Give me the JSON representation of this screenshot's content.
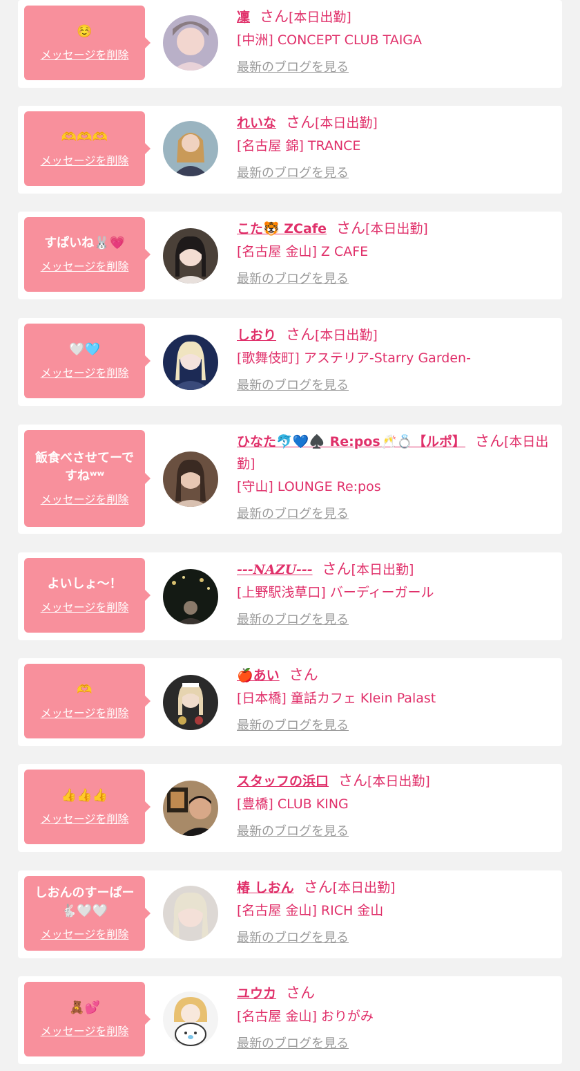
{
  "entries": [
    {
      "message": "☺️",
      "delete_label": "メッセージを削除",
      "name": "凜",
      "san": "さん",
      "status": "[本日出勤]",
      "shop": "[中洲] CONCEPT CLUB TAIGA",
      "blog_label": "最新のブログを見る"
    },
    {
      "message": "🫶🫶🫶",
      "delete_label": "メッセージを削除",
      "name": "れいな",
      "san": "さん",
      "status": "[本日出勤]",
      "shop": "[名古屋 錦] TRANCE",
      "blog_label": "最新のブログを見る"
    },
    {
      "message": "すぱいね🐰💗",
      "delete_label": "メッセージを削除",
      "name": "こた🐯 ZCafe",
      "san": "さん",
      "status": "[本日出勤]",
      "shop": "[名古屋 金山] Z CAFE",
      "blog_label": "最新のブログを見る"
    },
    {
      "message": "🤍🩵",
      "delete_label": "メッセージを削除",
      "name": "しおり",
      "san": "さん",
      "status": "[本日出勤]",
      "shop": "[歌舞伎町] アステリア-Starry Garden-",
      "blog_label": "最新のブログを見る"
    },
    {
      "message": "飯食べさせてーですねʷʷ",
      "delete_label": "メッセージを削除",
      "name": "ひなた🐬💙♠️ Re:pos🥂💍【ルポ】",
      "san": "さん",
      "status": "[本日出勤]",
      "shop": "[守山] LOUNGE Re:pos",
      "blog_label": "最新のブログを見る"
    },
    {
      "message": "よいしょ〜！",
      "delete_label": "メッセージを削除",
      "name": "---NAZU---",
      "san": "さん",
      "status": "[本日出勤]",
      "shop": "[上野駅浅草口] バーディーガール",
      "blog_label": "最新のブログを見る"
    },
    {
      "message": "🫶",
      "delete_label": "メッセージを削除",
      "name": "🍎あい",
      "san": "さん",
      "status": "",
      "shop": "[日本橋] 童話カフェ Klein Palast",
      "blog_label": "最新のブログを見る"
    },
    {
      "message": "👍👍👍",
      "delete_label": "メッセージを削除",
      "name": "スタッフの浜口",
      "san": "さん",
      "status": "[本日出勤]",
      "shop": "[豊橋] CLUB KING",
      "blog_label": "最新のブログを見る"
    },
    {
      "message": "しおんのすーぱー🐇🤍🤍",
      "delete_label": "メッセージを削除",
      "name": "椿 しおん",
      "san": "さん",
      "status": "[本日出勤]",
      "shop": "[名古屋 金山] RICH 金山",
      "blog_label": "最新のブログを見る"
    },
    {
      "message": "🧸💕",
      "delete_label": "メッセージを削除",
      "name": "ユウカ",
      "san": "さん",
      "status": "",
      "shop": "[名古屋 金山] おりがみ",
      "blog_label": "最新のブログを見る"
    }
  ]
}
